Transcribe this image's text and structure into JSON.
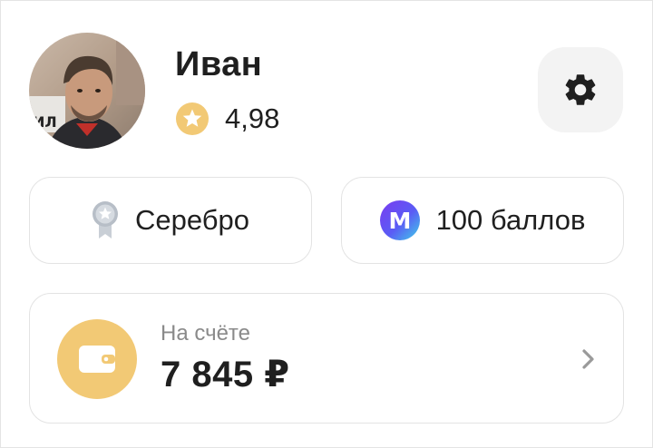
{
  "profile": {
    "name": "Иван",
    "rating": "4,98",
    "rating_icon": "star-badge-icon",
    "avatar_icon": "avatar-photo"
  },
  "settings": {
    "icon": "gear-icon"
  },
  "status": {
    "label": "Серебро",
    "icon": "silver-medal-icon"
  },
  "points": {
    "label": "100 баллов",
    "icon": "plus-m-logo-icon"
  },
  "balance": {
    "label": "На счёте",
    "amount": "7 845 ₽",
    "icon": "wallet-icon",
    "chevron": "chevron-right-icon"
  },
  "colors": {
    "accent_yellow": "#f2c975",
    "text_primary": "#1f1f1f",
    "text_secondary": "#8a8a8a",
    "card_border": "#e3e3e3",
    "settings_bg": "#f3f3f3"
  }
}
